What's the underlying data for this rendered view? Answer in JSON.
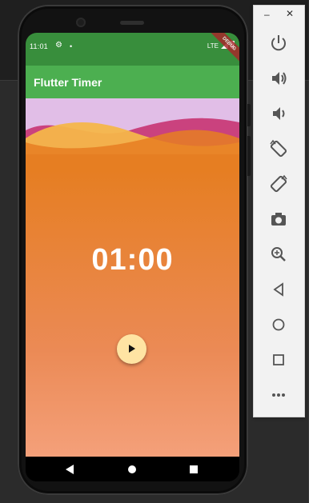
{
  "status_bar": {
    "time": "11:01",
    "network": "LTE",
    "settings_icon": "gear-icon",
    "notification_icon": "dot-icon"
  },
  "debug_banner": {
    "label": "DEBUG",
    "color": "#A52A2A"
  },
  "app_bar": {
    "title": "Flutter Timer",
    "color": "#4CAF50",
    "status_color": "#388E3C"
  },
  "timer": {
    "display": "01:00"
  },
  "fab": {
    "icon": "play-icon",
    "color": "#FFE4A3"
  },
  "nav_bar": {
    "icons": [
      "back-icon",
      "home-icon",
      "recent-apps-icon"
    ]
  },
  "background": {
    "top_color": "#E1BEE7",
    "gradient_start": "#E67E22",
    "gradient_end": "#F4A07A"
  },
  "emulator_panel": {
    "window_controls": [
      "minimize",
      "close"
    ],
    "buttons": [
      "power-icon",
      "volume-up-icon",
      "volume-down-icon",
      "rotate-left-icon",
      "rotate-right-icon",
      "camera-icon",
      "zoom-icon",
      "back-icon",
      "home-icon",
      "overview-icon",
      "more-icon"
    ],
    "minimize_glyph": "–",
    "close_glyph": "✕"
  }
}
